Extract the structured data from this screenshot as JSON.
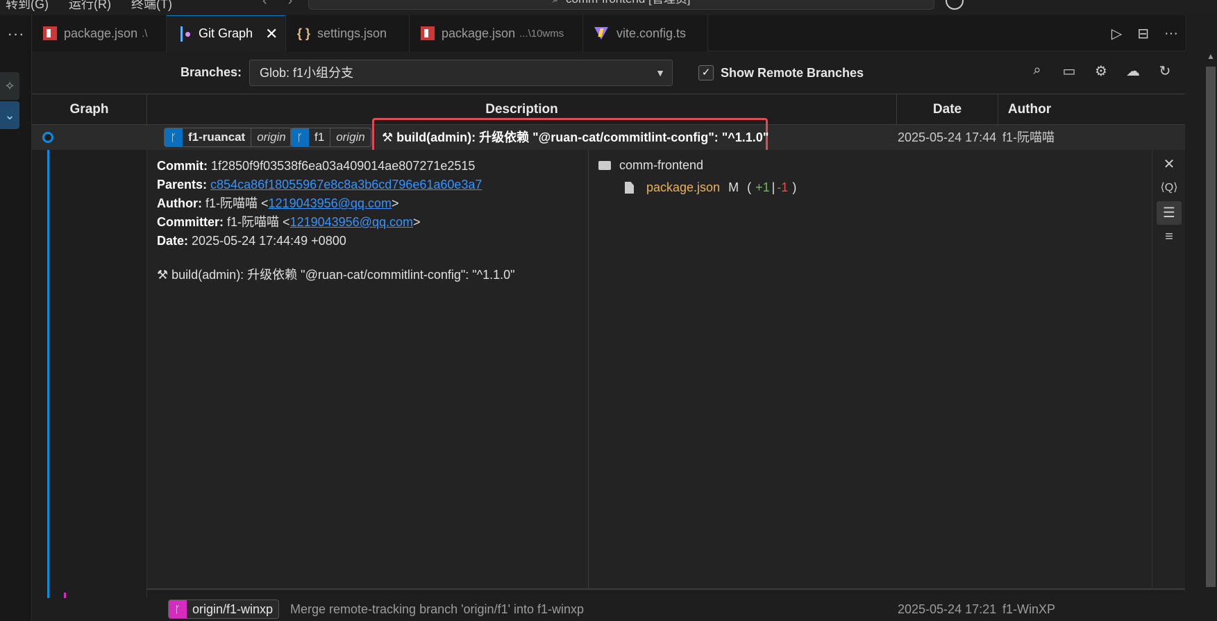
{
  "titlebar": {
    "menu": [
      "转到(G)",
      "运行(R)",
      "终端(T)"
    ],
    "command_center": "comm-frontend [管理员]"
  },
  "tabs": [
    {
      "label": "package.json",
      "desc": ".\\",
      "icon": "npm-icon"
    },
    {
      "label": "Git Graph",
      "desc": "",
      "icon": "git-graph-icon",
      "active": true
    },
    {
      "label": "settings.json",
      "desc": "",
      "icon": "braces-icon"
    },
    {
      "label": "package.json",
      "desc": "...\\10wms",
      "icon": "npm-icon"
    },
    {
      "label": "vite.config.ts",
      "desc": "",
      "icon": "vite-icon"
    }
  ],
  "controls": {
    "branches_label": "Branches:",
    "branches_value": "Glob: f1小组分支",
    "show_remote_label": "Show Remote Branches",
    "show_remote_checked": true
  },
  "table": {
    "headers": [
      "Graph",
      "Description",
      "Date",
      "Author"
    ]
  },
  "selected_commit": {
    "refs": [
      {
        "name": "f1-ruancat",
        "remote": "origin"
      },
      {
        "name": "f1",
        "remote": "origin"
      }
    ],
    "message": "build(admin): 升级依赖 \"@ruan-cat/commitlint-config\": \"^1.1.0\"",
    "date": "2025-05-24 17:44",
    "author": "f1-阮喵喵"
  },
  "details": {
    "commit_label": "Commit:",
    "commit_hash": "1f2850f9f03538f6ea03a409014ae807271e2515",
    "parents_label": "Parents:",
    "parents_hash": "c854ca86f18055967e8c8a3b6cd796e61a60e3a7",
    "author_label": "Author:",
    "author_name": "f1-阮喵喵 <",
    "author_email": "1219043956@qq.com",
    "committer_label": "Committer:",
    "committer_name": "f1-阮喵喵 <",
    "committer_email": "1219043956@qq.com",
    "date_label": "Date:",
    "date_value": "2025-05-24 17:44:49 +0800",
    "email_close": ">",
    "message": "build(admin): 升级依赖 \"@ruan-cat/commitlint-config\": \"^1.1.0\"",
    "folder": "comm-frontend",
    "file_name": "package.json",
    "file_status": "M",
    "open_paren": "(",
    "additions": "+1",
    "separator": "|",
    "deletions": "-1",
    "close_paren": ")"
  },
  "next_commit": {
    "ref": "origin/f1-winxp",
    "message": "Merge remote-tracking branch 'origin/f1' into f1-winxp",
    "date": "2025-05-24 17:21",
    "author": "f1-WinXP"
  },
  "colors": {
    "accent": "#0a8de0",
    "highlight": "#e04c56",
    "pink_branch": "#d62bbf",
    "link": "#3794ff"
  }
}
